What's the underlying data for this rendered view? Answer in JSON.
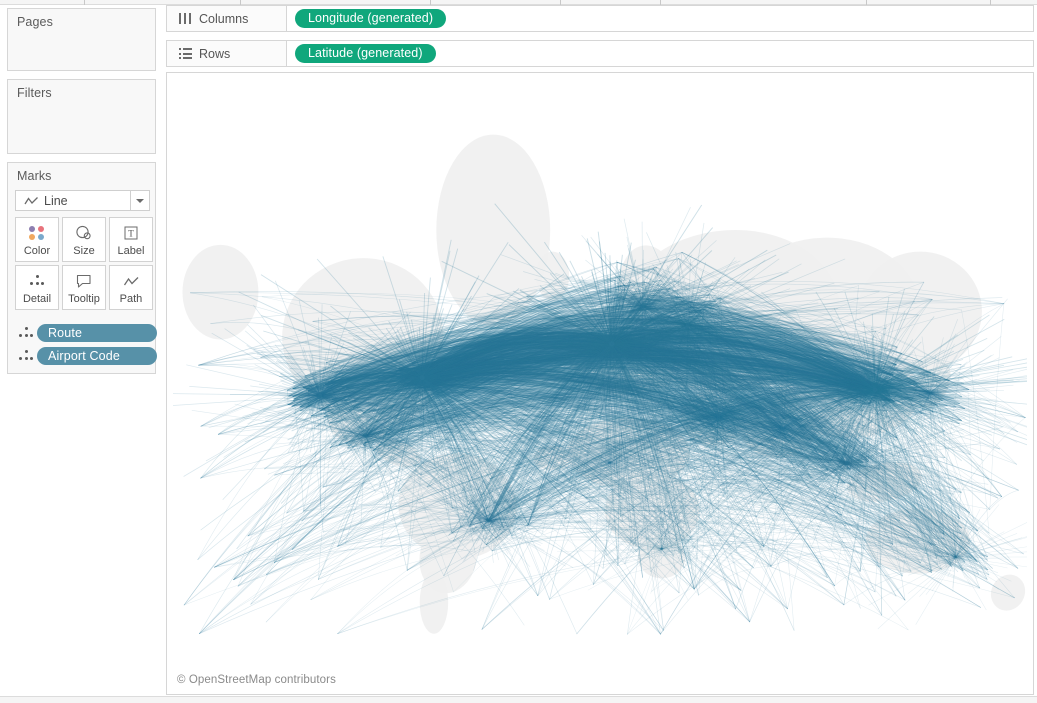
{
  "panels": {
    "pages": {
      "title": "Pages"
    },
    "filters": {
      "title": "Filters"
    },
    "marks": {
      "title": "Marks",
      "mark_type": {
        "label": "Line",
        "icon": "line-chart-icon"
      },
      "buttons": [
        {
          "label": "Color",
          "icon": "color-palette-icon"
        },
        {
          "label": "Size",
          "icon": "size-icon"
        },
        {
          "label": "Label",
          "icon": "text-label-icon"
        },
        {
          "label": "Detail",
          "icon": "detail-dots-icon"
        },
        {
          "label": "Tooltip",
          "icon": "tooltip-bubble-icon"
        },
        {
          "label": "Path",
          "icon": "path-line-icon"
        }
      ],
      "pills": [
        {
          "label": "Route",
          "icon": "detail-dots-icon",
          "color": "#5791a8"
        },
        {
          "label": "Airport Code",
          "icon": "detail-dots-icon",
          "color": "#5791a8"
        }
      ]
    }
  },
  "shelves": [
    {
      "name": "columns",
      "label": "Columns",
      "icon": "columns-bars-icon",
      "pills": [
        {
          "label": "Longitude (generated)",
          "color": "#10a77c"
        }
      ]
    },
    {
      "name": "rows",
      "label": "Rows",
      "icon": "rows-lines-icon",
      "pills": [
        {
          "label": "Latitude (generated)",
          "color": "#10a77c"
        }
      ]
    }
  ],
  "view": {
    "attribution": "© OpenStreetMap contributors",
    "map_line_color": "#2b7899",
    "land_color": "#f0f0f0",
    "background_color": "#ffffff"
  },
  "chart_data": {
    "type": "line",
    "title": "",
    "description": "World map of airline routes drawn as great-circle lines between airports",
    "xlabel": "Longitude (generated)",
    "ylabel": "Latitude (generated)",
    "xlim": [
      -180,
      180
    ],
    "ylim": [
      -60,
      84
    ],
    "grid": false,
    "legend": null,
    "series": [
      {
        "name": "Route",
        "color": "#2b7899",
        "mark": "line"
      }
    ],
    "hubs": [
      {
        "name": "North America East",
        "x": -75,
        "y": 40,
        "density": 0.92
      },
      {
        "name": "North America West",
        "x": -118,
        "y": 34,
        "density": 0.62
      },
      {
        "name": "Central America",
        "x": -99,
        "y": 19,
        "density": 0.48
      },
      {
        "name": "Western Europe",
        "x": 5,
        "y": 50,
        "density": 1.0
      },
      {
        "name": "Northern Europe",
        "x": 18,
        "y": 59,
        "density": 0.55
      },
      {
        "name": "Eastern Europe",
        "x": 37,
        "y": 55,
        "density": 0.58
      },
      {
        "name": "Middle East",
        "x": 50,
        "y": 26,
        "density": 0.5
      },
      {
        "name": "South Asia",
        "x": 77,
        "y": 22,
        "density": 0.45
      },
      {
        "name": "East Asia",
        "x": 116,
        "y": 36,
        "density": 0.78
      },
      {
        "name": "Southeast Asia",
        "x": 104,
        "y": 8,
        "density": 0.52
      },
      {
        "name": "Japan",
        "x": 139,
        "y": 35,
        "density": 0.44
      },
      {
        "name": "Australia",
        "x": 150,
        "y": -30,
        "density": 0.3
      },
      {
        "name": "Brazil",
        "x": -47,
        "y": -16,
        "density": 0.42
      },
      {
        "name": "Southern Africa",
        "x": 26,
        "y": -27,
        "density": 0.22
      },
      {
        "name": "West Africa",
        "x": 4,
        "y": 8,
        "density": 0.2
      }
    ]
  }
}
